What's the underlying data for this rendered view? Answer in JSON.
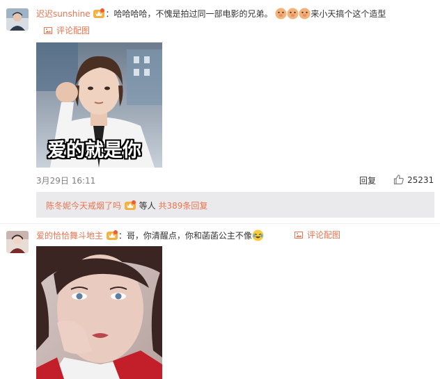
{
  "comments": [
    {
      "username": "迟迟sunshine",
      "colon": "：",
      "text": "哈哈哈哈，不愧是拍过同一部电影的兄弟。",
      "text_after_emoji": "来小天搞个这个造型",
      "emoji_names": [
        "doge-icon",
        "doge-icon",
        "doge-icon"
      ],
      "pic_link": "评论配图",
      "image_caption": "爱的就是你",
      "timestamp": "3月29日 16:11",
      "reply_label": "回复",
      "like_count": "25231",
      "sub_reply": {
        "user": "陈冬妮今天戒烟了吗",
        "middle": "等人",
        "total": "共389条回复"
      }
    },
    {
      "username": "爱的恰恰舞斗地主",
      "colon": "：",
      "text": "哥，你清醒点，你和菡菡公主不像",
      "emoji_names": [
        "laugh-cry-icon"
      ],
      "pic_link": "评论配图"
    }
  ],
  "colors": {
    "accent": "#eb7350",
    "meta_gray": "#808080",
    "sub_box_bg": "#eaeaec"
  }
}
